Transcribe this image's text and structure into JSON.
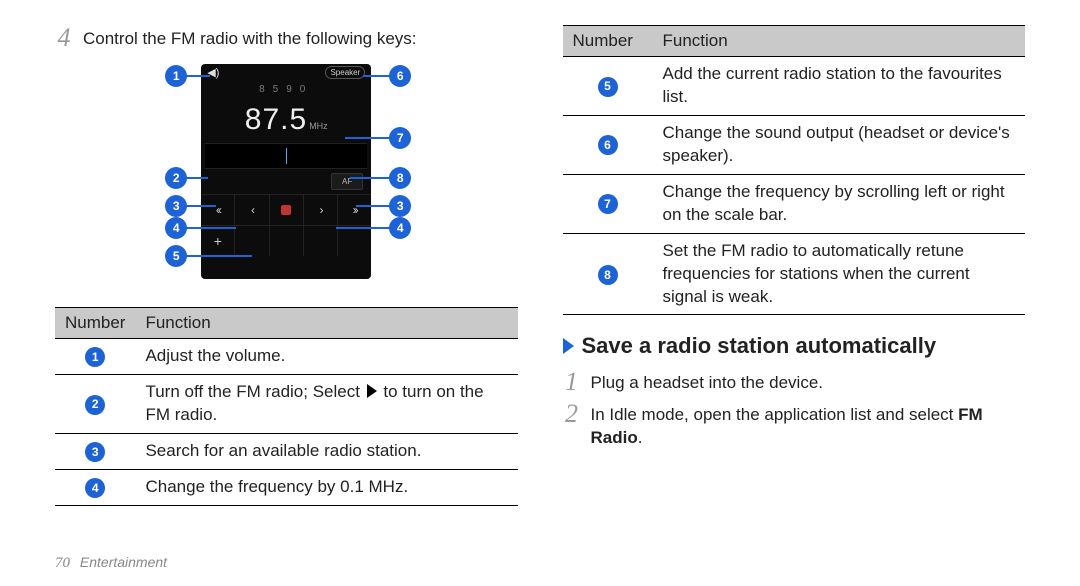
{
  "left": {
    "step4": {
      "num": "4",
      "text": "Control the FM radio with the following keys:"
    },
    "phone": {
      "marks_left": "85",
      "marks_right": "90",
      "freq": "87.5",
      "unit": "MHz",
      "speaker_label": "Speaker",
      "af_label": "AF"
    },
    "callouts": {
      "c1": "1",
      "c2": "2",
      "c3": "3",
      "c4": "4",
      "c5": "5",
      "c6": "6",
      "c7": "7",
      "c8": "8"
    },
    "table1": {
      "hdr_num": "Number",
      "hdr_fn": "Function",
      "rows": [
        {
          "n": "1",
          "fn": "Adjust the volume."
        },
        {
          "n": "2",
          "fn_before": "Turn off the FM radio; Select ",
          "fn_after": " to turn on the FM radio."
        },
        {
          "n": "3",
          "fn": "Search for an available radio station."
        },
        {
          "n": "4",
          "fn": "Change the frequency by 0.1 MHz."
        }
      ]
    }
  },
  "right": {
    "table2": {
      "hdr_num": "Number",
      "hdr_fn": "Function",
      "rows": [
        {
          "n": "5",
          "fn": "Add the current radio station to the favourites list."
        },
        {
          "n": "6",
          "fn": "Change the sound output (headset or device's speaker)."
        },
        {
          "n": "7",
          "fn": "Change the frequency by scrolling left or right on the scale bar."
        },
        {
          "n": "8",
          "fn": "Set the FM radio to automatically retune frequencies for stations when the current signal is weak."
        }
      ]
    },
    "section_title": "Save a radio station automatically",
    "step1": {
      "num": "1",
      "text": "Plug a headset into the device."
    },
    "step2": {
      "num": "2",
      "text_before": "In Idle mode, open the application list and select ",
      "bold": "FM Radio",
      "text_after": "."
    }
  },
  "footer": {
    "page": "70",
    "chapter": "Entertainment"
  }
}
